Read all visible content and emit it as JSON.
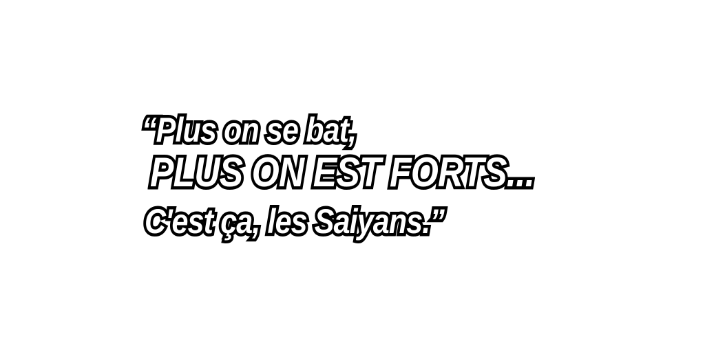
{
  "quote": {
    "line1": "“Plus on se bat,",
    "line2": "PLUS ON EST FORTS...",
    "line3": "C'est ça, les Saiyans.”"
  },
  "colors": {
    "background": "#ffffff",
    "text_fill": "#ffffff",
    "text_outline": "#000000"
  }
}
